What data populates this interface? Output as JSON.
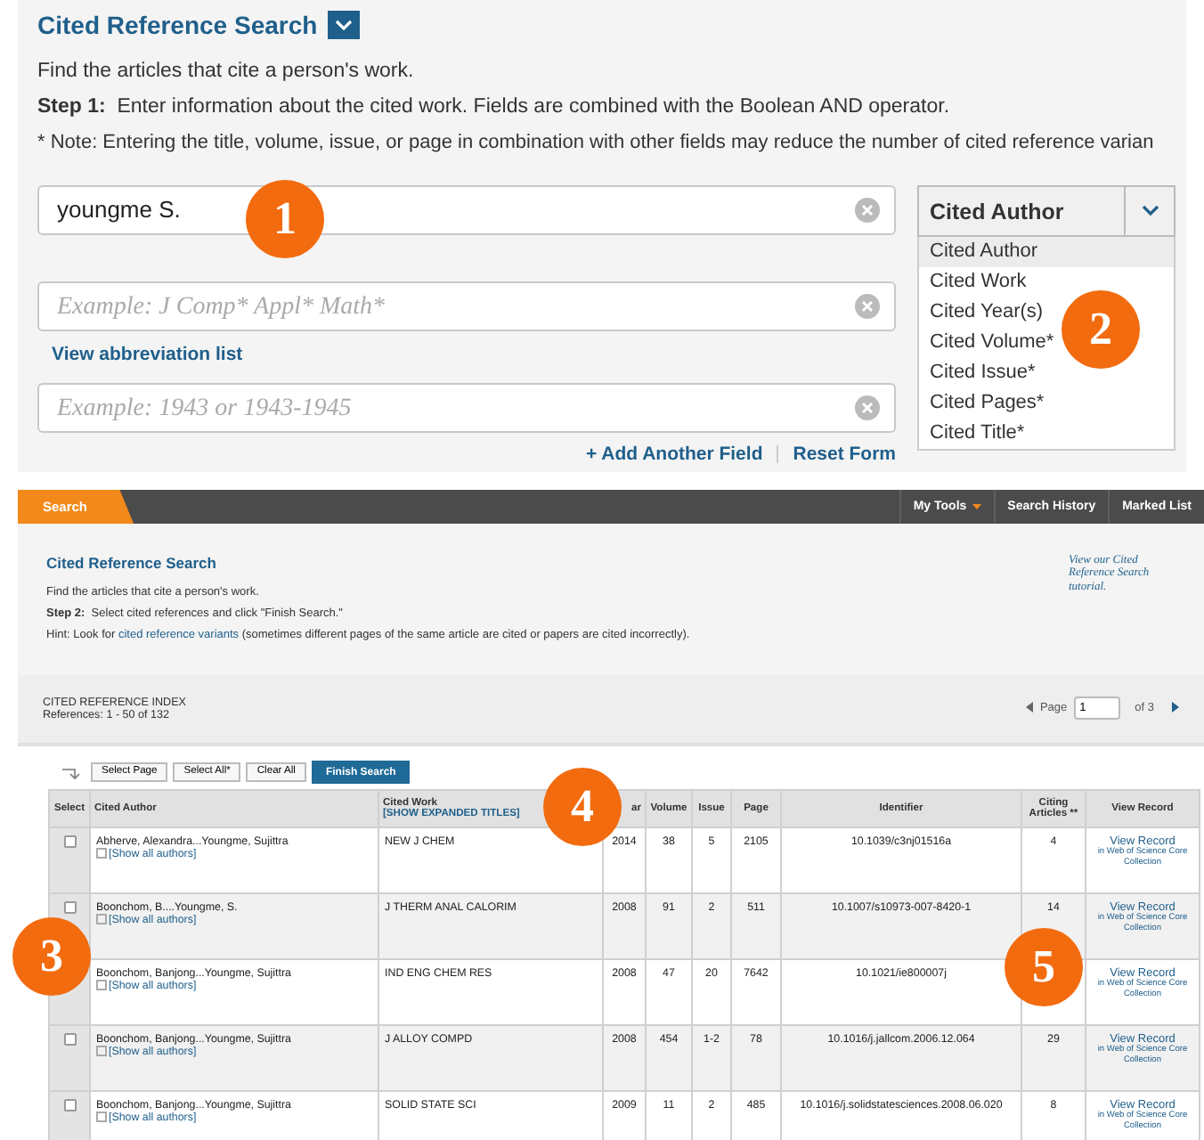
{
  "search_form": {
    "title": "Cited Reference Search",
    "intro": "Find the articles that cite a person's work.",
    "step_label": "Step 1:",
    "step_text": "Enter information about the cited work. Fields are combined with the Boolean AND operator.",
    "note": "* Note: Entering the title, volume, issue, or page in combination with other fields may reduce the number of cited reference varian",
    "fields": [
      {
        "value": "youngme S."
      },
      {
        "placeholder": "Example: J Comp* Appl* Math*"
      },
      {
        "placeholder": "Example: 1943 or 1943-1945"
      }
    ],
    "abbreviation_link": "View abbreviation list",
    "field_select": {
      "value": "Cited Author",
      "expanded": true,
      "options": [
        {
          "label": "Cited Author",
          "selected": true
        },
        {
          "label": "Cited Work",
          "selected": false
        },
        {
          "label": "Cited Year(s)",
          "selected": false
        },
        {
          "label": "Cited Volume*",
          "selected": false
        },
        {
          "label": "Cited Issue*",
          "selected": false
        },
        {
          "label": "Cited Pages*",
          "selected": false
        },
        {
          "label": "Cited Title*",
          "selected": false
        }
      ]
    },
    "actions": [
      "+ Add Another Field",
      "Reset Form"
    ]
  },
  "nav": {
    "tab": "Search",
    "menu": [
      {
        "label": "My Tools",
        "dropdown": true
      },
      {
        "label": "Search History",
        "dropdown": false
      },
      {
        "label": "Marked List",
        "dropdown": false
      }
    ]
  },
  "results": {
    "title": "Cited Reference Search",
    "intro": "Find the articles that cite a person's work.",
    "step_label": "Step 2:",
    "step_text": "Select cited references and click \"Finish Search.\"",
    "hint_before": "Hint: Look for",
    "hint_link": "cited reference variants",
    "hint_after": "(sometimes different pages of the same article are cited or papers are cited incorrectly).",
    "tutorial": "View our Cited Reference Search tutorial.",
    "index_title": "CITED REFERENCE INDEX",
    "references": "References:  1 - 50 of 132",
    "pager": {
      "label": "Page",
      "value": "1",
      "total": "of  3"
    },
    "buttons": [
      "Select Page",
      "Select All*",
      "Clear All"
    ],
    "finish": "Finish Search",
    "columns": [
      {
        "label": "Select"
      },
      {
        "label": "Cited Author"
      },
      {
        "label": "Cited Work",
        "sub": "[SHOW EXPANDED TITLES]"
      },
      {
        "label": "ar"
      },
      {
        "label": "Volume"
      },
      {
        "label": "Issue"
      },
      {
        "label": "Page"
      },
      {
        "label": "Identifier"
      },
      {
        "label": "Citing Articles **"
      },
      {
        "label": "View Record"
      }
    ],
    "rows": [
      {
        "checked": false,
        "author": "Abherve, Alexandra...Youngme, Sujittra",
        "show_all": "[Show all authors]",
        "work": "NEW J CHEM",
        "year": "2014",
        "volume": "38",
        "issue": "5",
        "page": "2105",
        "identifier": "10.1039/c3nj01516a",
        "citing": "4",
        "view": "View Record",
        "view_sub": "in Web of Science Core Collection"
      },
      {
        "checked": false,
        "author": "Boonchom, B....Youngme, S.",
        "show_all": "[Show all authors]",
        "work": "J THERM ANAL CALORIM",
        "year": "2008",
        "volume": "91",
        "issue": "2",
        "page": "511",
        "identifier": "10.1007/s10973-007-8420-1",
        "citing": "14",
        "view": "View Record",
        "view_sub": "in Web of Science Core Collection"
      },
      {
        "author": "Boonchom, Banjong...Youngme, Sujittra",
        "show_all": "[Show all authors]",
        "work": "IND ENG CHEM RES",
        "year": "2008",
        "volume": "47",
        "issue": "20",
        "page": "7642",
        "identifier": "10.1021/ie800007j",
        "view": "View Record",
        "view_sub": "in Web of Science Core Collection"
      },
      {
        "checked": false,
        "author": "Boonchom, Banjong...Youngme, Sujittra",
        "show_all": "[Show all authors]",
        "work": "J ALLOY COMPD",
        "year": "2008",
        "volume": "454",
        "issue": "1-2",
        "page": "78",
        "identifier": "10.1016/j.jallcom.2006.12.064",
        "citing": "29",
        "view": "View Record",
        "view_sub": "in Web of Science Core Collection"
      },
      {
        "checked": false,
        "author": "Boonchom, Banjong...Youngme, Sujittra",
        "show_all": "[Show all authors]",
        "work": "SOLID STATE SCI",
        "year": "2009",
        "volume": "11",
        "issue": "2",
        "page": "485",
        "identifier": "10.1016/j.solidstatesciences.2008.06.020",
        "citing": "8",
        "view": "View Record",
        "view_sub": "in Web of Science Core Collection"
      }
    ]
  },
  "callouts": [
    "1",
    "2",
    "3",
    "4",
    "5"
  ]
}
